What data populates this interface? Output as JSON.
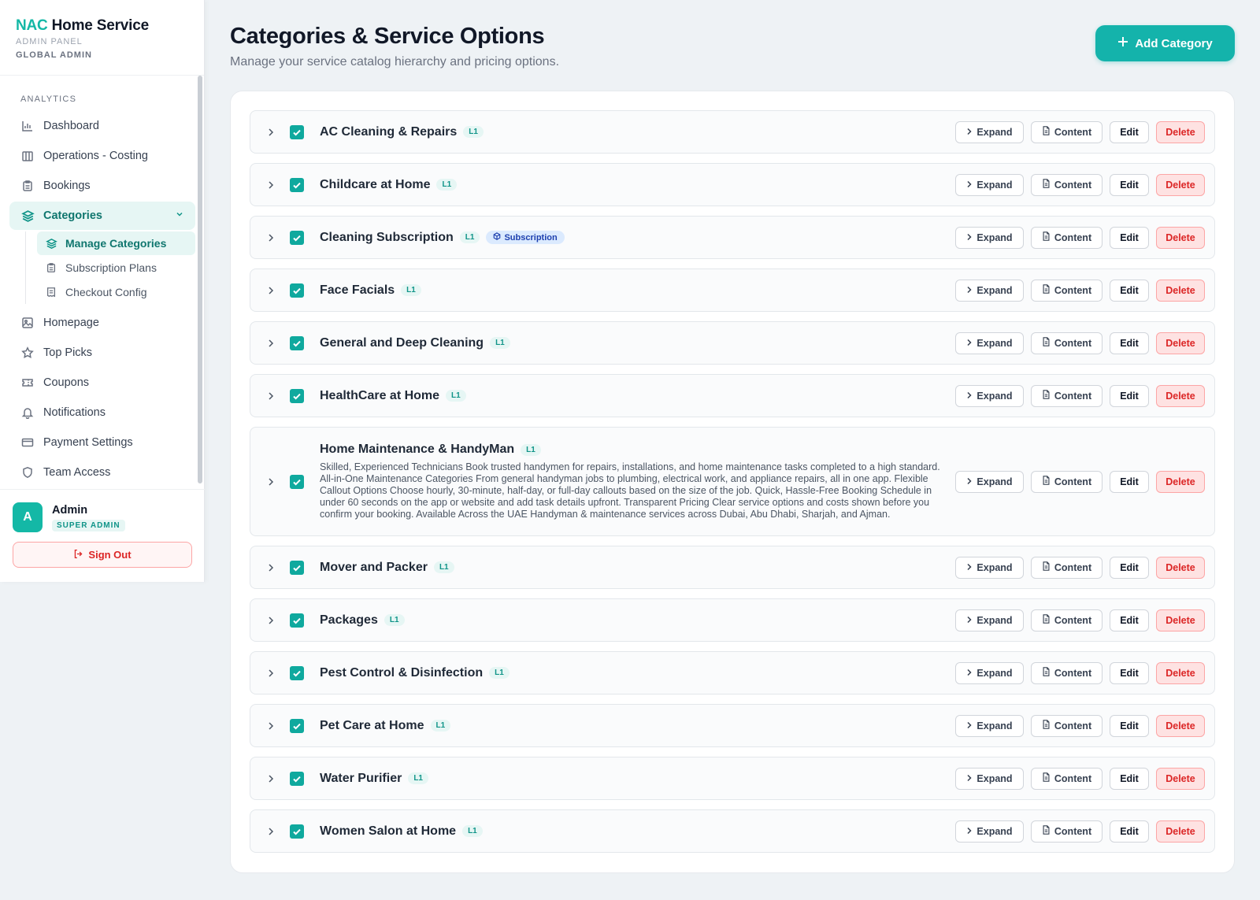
{
  "brand": {
    "title_accent": "NAC",
    "title_rest": " Home Service",
    "subtitle": "ADMIN PANEL",
    "role": "GLOBAL ADMIN"
  },
  "nav": {
    "section": "ANALYTICS",
    "items": [
      {
        "label": "Dashboard",
        "icon": "bar-chart-icon"
      },
      {
        "label": "Operations - Costing",
        "icon": "building-icon"
      },
      {
        "label": "Bookings",
        "icon": "clipboard-icon"
      },
      {
        "label": "Categories",
        "icon": "layers-icon"
      },
      {
        "label": "Homepage",
        "icon": "image-icon"
      },
      {
        "label": "Top Picks",
        "icon": "star-icon"
      },
      {
        "label": "Coupons",
        "icon": "ticket-icon"
      },
      {
        "label": "Notifications",
        "icon": "bell-icon"
      },
      {
        "label": "Payment Settings",
        "icon": "credit-card-icon"
      },
      {
        "label": "Team Access",
        "icon": "shield-icon"
      }
    ],
    "sub_items": [
      {
        "label": "Manage Categories",
        "icon": "layers-icon"
      },
      {
        "label": "Subscription Plans",
        "icon": "clipboard-icon"
      },
      {
        "label": "Checkout Config",
        "icon": "receipt-icon"
      }
    ]
  },
  "profile": {
    "avatar": "A",
    "name": "Admin",
    "role": "SUPER ADMIN",
    "signout": "Sign Out"
  },
  "header": {
    "title": "Categories & Service Options",
    "subtitle": "Manage your service catalog hierarchy and pricing options.",
    "add_button": "Add Category"
  },
  "buttons": {
    "expand": "Expand",
    "content": "Content",
    "edit": "Edit",
    "delete": "Delete"
  },
  "categories": [
    {
      "name": "AC Cleaning & Repairs",
      "level": "L1"
    },
    {
      "name": "Childcare at Home",
      "level": "L1"
    },
    {
      "name": "Cleaning Subscription",
      "level": "L1",
      "badge": "Subscription"
    },
    {
      "name": "Face Facials",
      "level": "L1"
    },
    {
      "name": "General and Deep Cleaning",
      "level": "L1"
    },
    {
      "name": "HealthCare at Home",
      "level": "L1"
    },
    {
      "name": "Home Maintenance & HandyMan",
      "level": "L1",
      "description": "Skilled, Experienced Technicians Book trusted handymen for repairs, installations, and home maintenance tasks completed to a high standard. All-in-One Maintenance Categories From general handyman jobs to plumbing, electrical work, and appliance repairs, all in one app. Flexible Callout Options Choose hourly, 30-minute, half-day, or full-day callouts based on the size of the job. Quick, Hassle-Free Booking Schedule in under 60 seconds on the app or website and add task details upfront. Transparent Pricing Clear service options and costs shown before you confirm your booking. Available Across the UAE Handyman & maintenance services across Dubai, Abu Dhabi, Sharjah, and Ajman."
    },
    {
      "name": "Mover and Packer",
      "level": "L1"
    },
    {
      "name": "Packages",
      "level": "L1"
    },
    {
      "name": "Pest Control & Disinfection",
      "level": "L1"
    },
    {
      "name": "Pet Care at Home",
      "level": "L1"
    },
    {
      "name": "Water Purifier",
      "level": "L1"
    },
    {
      "name": "Women Salon at Home",
      "level": "L1"
    }
  ]
}
